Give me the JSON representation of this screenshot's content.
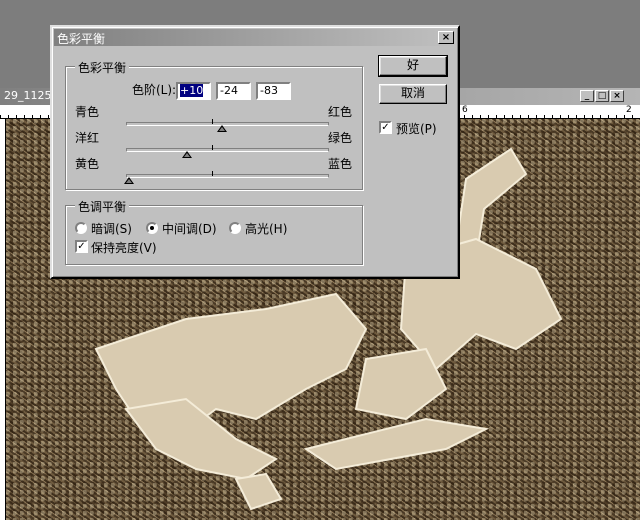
{
  "background_window": {
    "title": "29_1125",
    "ruler_numbers": [
      "6",
      "2"
    ],
    "buttons": {
      "minimize": "_",
      "maximize": "□",
      "close": "×"
    }
  },
  "dialog": {
    "title": "色彩平衡",
    "close_glyph": "×",
    "color_balance": {
      "group_label": "色彩平衡",
      "levels_label": "色阶(L):",
      "levels": [
        "+10",
        "-24",
        "-83"
      ],
      "sliders": [
        {
          "left": "青色",
          "right": "红色",
          "value": 10
        },
        {
          "left": "洋红",
          "right": "绿色",
          "value": -24
        },
        {
          "left": "黄色",
          "right": "蓝色",
          "value": -83
        }
      ]
    },
    "tone_balance": {
      "group_label": "色调平衡",
      "options": [
        {
          "label": "暗调(S)",
          "selected": false
        },
        {
          "label": "中间调(D)",
          "selected": true
        },
        {
          "label": "高光(H)",
          "selected": false
        }
      ],
      "preserve_luminosity": {
        "label": "保持亮度(V)",
        "checked": true
      }
    },
    "buttons": {
      "ok": "好",
      "cancel": "取消"
    },
    "preview": {
      "label": "预览(P)",
      "checked": true
    },
    "check_glyph": "✓"
  }
}
